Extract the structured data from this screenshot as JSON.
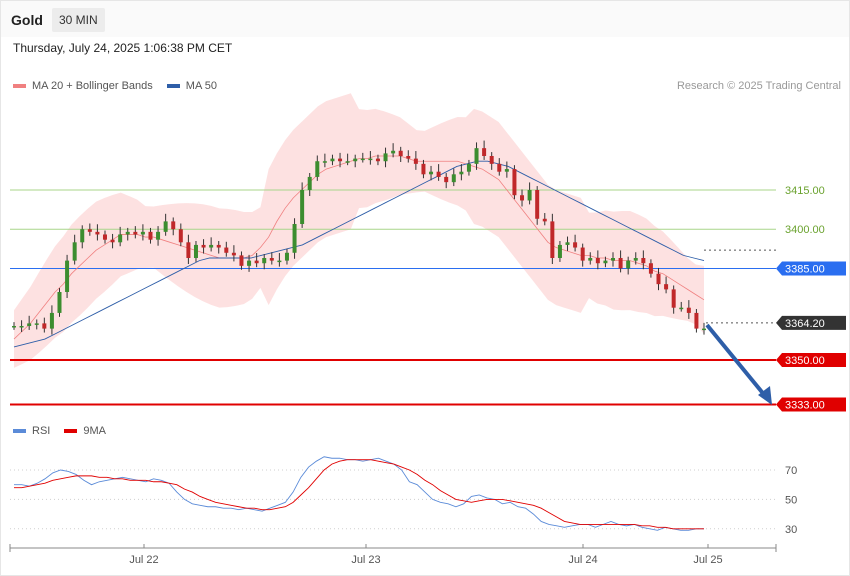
{
  "header": {
    "title": "Gold",
    "timeframe": "30 MIN"
  },
  "datetime": "Thursday, July 24, 2025 1:06:38 PM CET",
  "legend": {
    "ma20": {
      "label": "MA 20 + Bollinger Bands",
      "color": "#f08080"
    },
    "ma50": {
      "label": "MA 50",
      "color": "#2e5ea8"
    },
    "credit": "Research © 2025 Trading Central"
  },
  "rsi_legend": {
    "rsi": {
      "label": "RSI",
      "color": "#5b8bd8"
    },
    "ma9": {
      "label": "9MA",
      "color": "#e00000"
    }
  },
  "chart_data": {
    "type": "candlestick",
    "x_labels": [
      "Jul 22",
      "Jul 23",
      "Jul 24",
      "Jul 25"
    ],
    "price_levels": [
      {
        "value": 3415.0,
        "label": "3415.00",
        "kind": "line",
        "color": "#a8d58a",
        "text_color": "#6aa22e"
      },
      {
        "value": 3400.0,
        "label": "3400.00",
        "kind": "line",
        "color": "#a8d58a",
        "text_color": "#6aa22e"
      },
      {
        "value": 3385.0,
        "label": "3385.00",
        "kind": "pivot",
        "color": "#2a6ef0"
      },
      {
        "value": 3364.2,
        "label": "3364.20",
        "kind": "last",
        "color": "#333333"
      },
      {
        "value": 3350.0,
        "label": "3350.00",
        "kind": "support",
        "color": "#e00000"
      },
      {
        "value": 3333.0,
        "label": "3333.00",
        "kind": "support",
        "color": "#e00000"
      }
    ],
    "price": [
      3363,
      3363,
      3364,
      3364,
      3362,
      3368,
      3376,
      3388,
      3395,
      3400,
      3399,
      3398,
      3396,
      3395,
      3398,
      3399,
      3398,
      3399,
      3396,
      3399,
      3403,
      3400,
      3395,
      3389,
      3394,
      3393,
      3394,
      3393,
      3391,
      3390,
      3386,
      3388,
      3387,
      3389,
      3388,
      3388,
      3391,
      3402,
      3415,
      3420,
      3426,
      3426,
      3427,
      3426,
      3426,
      3427,
      3427,
      3427,
      3426,
      3429,
      3430,
      3428,
      3427,
      3425,
      3421,
      3422,
      3420,
      3418,
      3421,
      3422,
      3425,
      3431,
      3428,
      3425,
      3422,
      3423,
      3413,
      3411,
      3415,
      3404,
      3403,
      3389,
      3394,
      3395,
      3393,
      3388,
      3389,
      3387,
      3388,
      3389,
      3385,
      3388,
      3389,
      3387,
      3383,
      3379,
      3377,
      3370,
      3370,
      3368,
      3362,
      3362
    ],
    "ma20": [
      3358,
      3361,
      3364,
      3368,
      3372,
      3376,
      3379,
      3383,
      3386,
      3389,
      3392,
      3394,
      3396,
      3398,
      3398,
      3398,
      3397,
      3397,
      3396,
      3395,
      3394,
      3393,
      3392,
      3391,
      3390,
      3389,
      3389,
      3389,
      3389,
      3390,
      3393,
      3397,
      3403,
      3408,
      3412,
      3415,
      3418,
      3421,
      3423,
      3424,
      3425,
      3426,
      3427,
      3427,
      3428,
      3428,
      3428,
      3428,
      3427,
      3426,
      3426,
      3426,
      3426,
      3426,
      3426,
      3425,
      3424,
      3423,
      3421,
      3419,
      3415,
      3411,
      3407,
      3403,
      3399,
      3395,
      3393,
      3392,
      3391,
      3390,
      3390,
      3389,
      3389,
      3388,
      3388,
      3388,
      3387,
      3386,
      3384,
      3383,
      3381,
      3379,
      3377,
      3375,
      3373
    ],
    "ma50": [
      3355,
      3356,
      3357,
      3358,
      3360,
      3362,
      3364,
      3366,
      3368,
      3370,
      3372,
      3374,
      3376,
      3378,
      3380,
      3382,
      3384,
      3386,
      3388,
      3389,
      3389,
      3389,
      3389,
      3389,
      3390,
      3391,
      3392,
      3393,
      3394,
      3396,
      3398,
      3400,
      3402,
      3404,
      3406,
      3408,
      3410,
      3412,
      3414,
      3416,
      3418,
      3420,
      3422,
      3424,
      3425,
      3426,
      3426,
      3425,
      3424,
      3422,
      3420,
      3418,
      3416,
      3414,
      3412,
      3410,
      3408,
      3406,
      3404,
      3402,
      3400,
      3398,
      3396,
      3394,
      3392,
      3390,
      3389,
      3388
    ],
    "rsi": {
      "ticks": [
        "70",
        "50",
        "30"
      ],
      "rsi": [
        60,
        60,
        59,
        61,
        64,
        68,
        70,
        69,
        67,
        63,
        60,
        62,
        63,
        64,
        65,
        64,
        63,
        62,
        64,
        63,
        61,
        55,
        50,
        47,
        46,
        45,
        45,
        44,
        44,
        43,
        44,
        43,
        42,
        44,
        46,
        48,
        55,
        65,
        72,
        76,
        79,
        78,
        78,
        77,
        77,
        76,
        77,
        78,
        76,
        74,
        70,
        62,
        60,
        55,
        50,
        48,
        47,
        45,
        47,
        52,
        53,
        51,
        50,
        47,
        48,
        45,
        44,
        40,
        35,
        33,
        32,
        31,
        32,
        33,
        33,
        31,
        33,
        35,
        33,
        32,
        33,
        31,
        30,
        29,
        31,
        30,
        29,
        29,
        30,
        30
      ],
      "ma9": [
        58,
        58,
        59,
        60,
        61,
        63,
        64,
        65,
        66,
        66,
        66,
        65,
        65,
        64,
        64,
        63,
        63,
        63,
        62,
        62,
        61,
        60,
        57,
        55,
        52,
        50,
        48,
        47,
        46,
        45,
        44,
        44,
        43,
        43,
        44,
        45,
        48,
        53,
        58,
        64,
        70,
        74,
        76,
        77,
        77,
        77,
        77,
        76,
        75,
        74,
        72,
        70,
        67,
        63,
        60,
        56,
        53,
        50,
        49,
        48,
        49,
        50,
        50,
        50,
        49,
        48,
        47,
        46,
        44,
        41,
        38,
        35,
        34,
        33,
        33,
        33,
        33,
        33,
        33,
        33,
        33,
        32,
        32,
        31,
        31,
        30,
        30,
        30,
        30,
        30
      ]
    }
  }
}
